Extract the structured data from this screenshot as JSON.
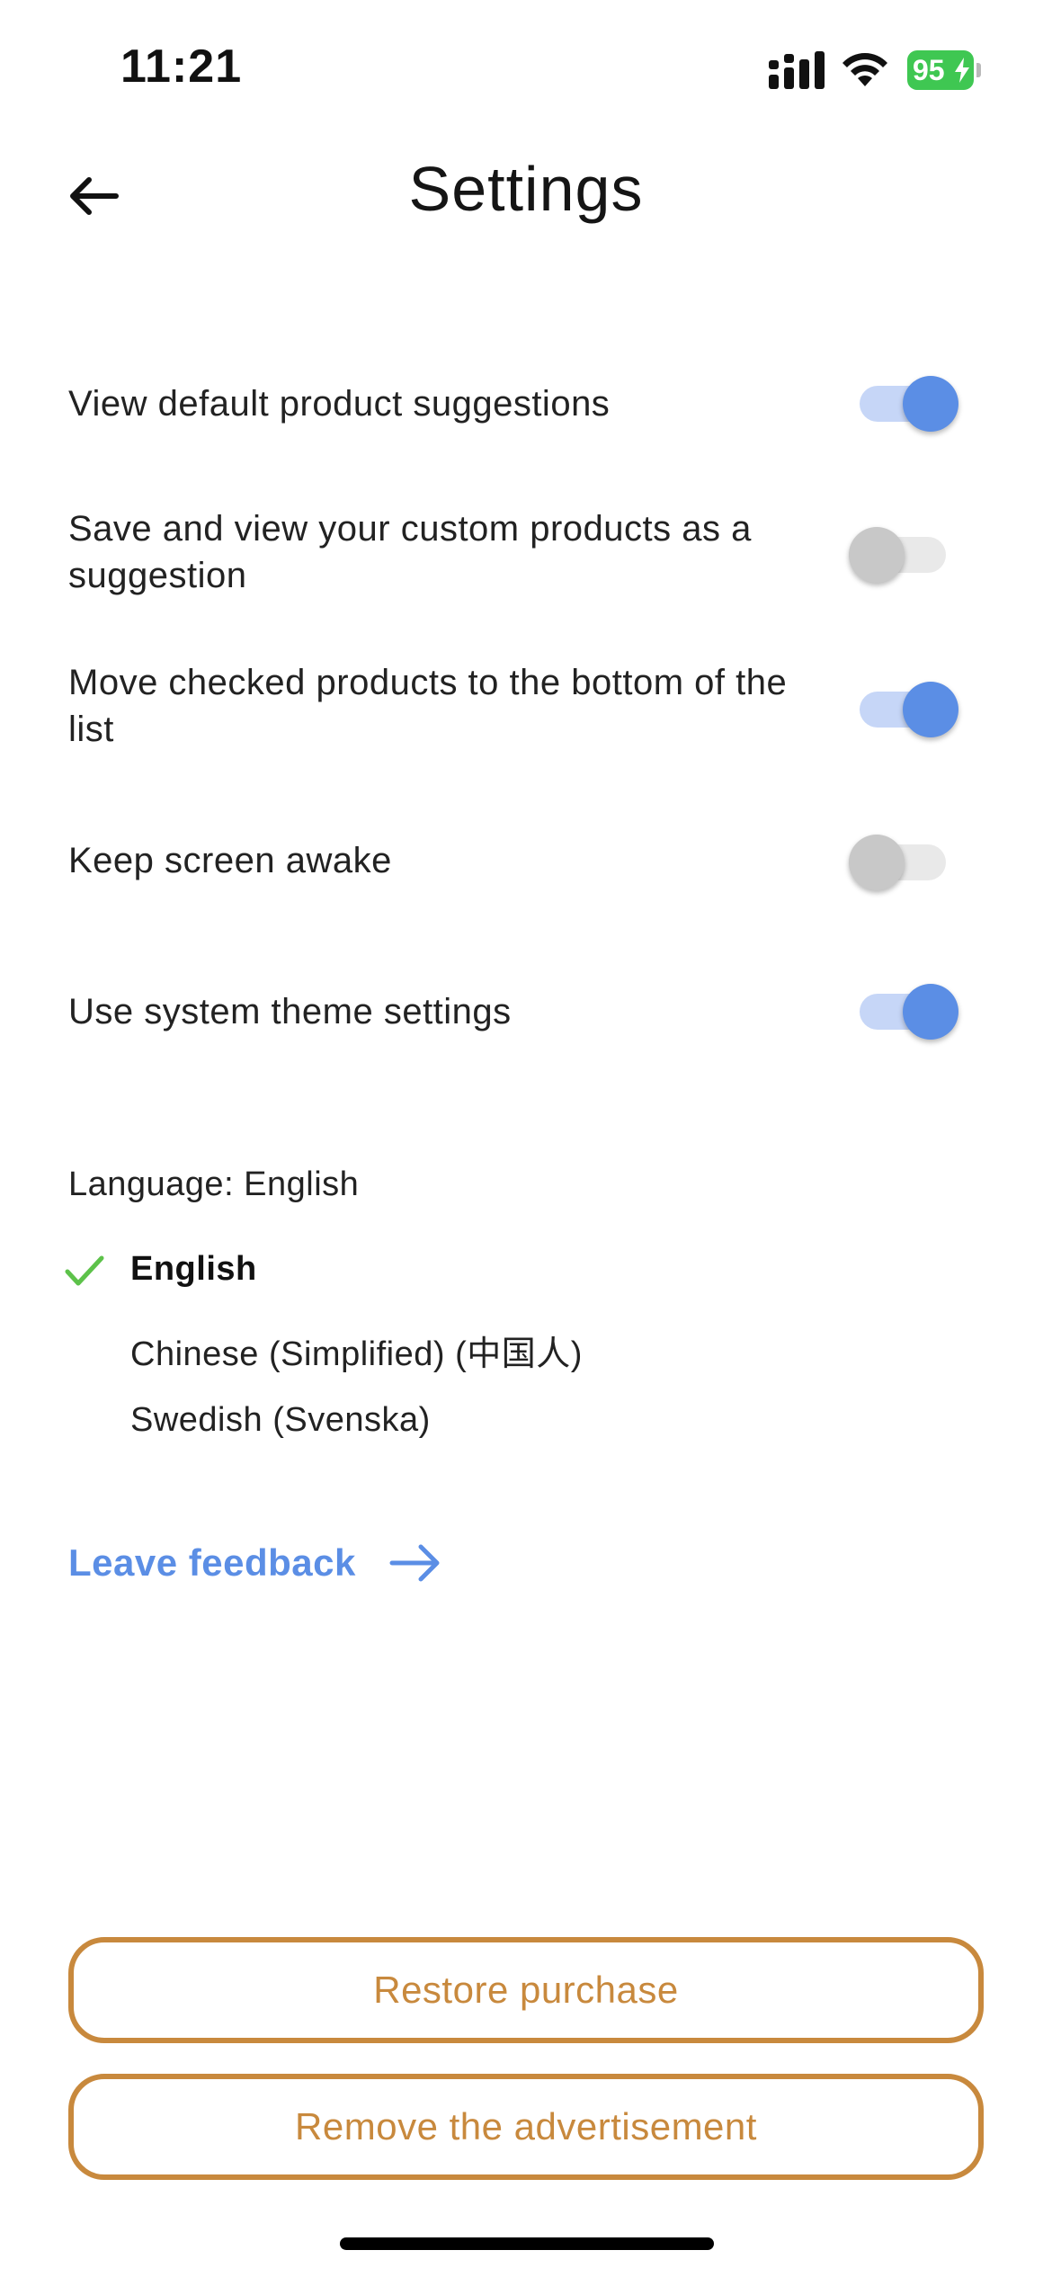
{
  "status_bar": {
    "time": "11:21",
    "battery_percent": "95",
    "battery_color": "#3fc752"
  },
  "header": {
    "title": "Settings",
    "back_icon": "arrow-left-icon"
  },
  "settings": [
    {
      "label": "View default product suggestions",
      "enabled": true
    },
    {
      "label": "Save and view your custom products as a suggestion",
      "enabled": false
    },
    {
      "label": "Move checked products to the bottom of the list",
      "enabled": true
    },
    {
      "label": "Keep screen awake",
      "enabled": false
    },
    {
      "label": "Use system theme settings",
      "enabled": true
    }
  ],
  "language": {
    "heading": "Language: English",
    "options": [
      {
        "label": "English",
        "selected": true
      },
      {
        "label": "Chinese (Simplified) (中国人)",
        "selected": false
      },
      {
        "label": "Swedish (Svenska)",
        "selected": false
      }
    ]
  },
  "feedback": {
    "label": "Leave feedback",
    "icon": "arrow-right-icon"
  },
  "buttons": {
    "restore": "Restore purchase",
    "remove_ads": "Remove the advertisement"
  },
  "colors": {
    "accent": "#5b8ee5",
    "toggle_on_track": "#c6d6f7",
    "toggle_off_knob": "#c8c8c8",
    "button_outline": "#c8893d",
    "check": "#5dc24a"
  }
}
